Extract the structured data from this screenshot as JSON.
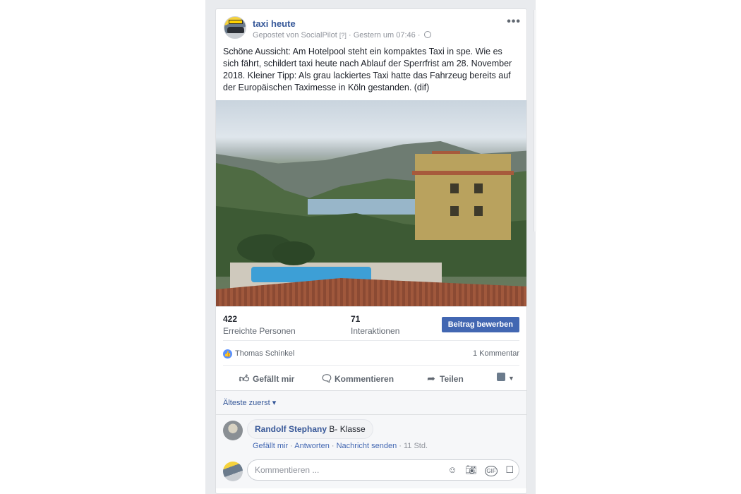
{
  "post": {
    "page_name": "taxi heute",
    "meta_prefix": "Gepostet von",
    "meta_tool": "SocialPilot",
    "meta_help": "[?]",
    "meta_time": "· Gestern um 07:46 ·",
    "text": "Schöne Aussicht: Am Hotelpool steht ein kompaktes Taxi in spe. Wie es sich fährt, schildert taxi heute nach Ablauf der Sperrfrist am 28. November 2018. Kleiner Tipp: Als grau lackiertes Taxi hatte das Fahrzeug bereits auf der Europäischen Taximesse in Köln gestanden. (dif)",
    "more": "•••"
  },
  "stats": {
    "reach_num": "422",
    "reach_label": "Erreichte Personen",
    "inter_num": "71",
    "inter_label": "Interaktionen",
    "boost": "Beitrag bewerben"
  },
  "reactions": {
    "liker": "Thomas Schinkel",
    "comment_count": "1 Kommentar"
  },
  "actions": {
    "like": "Gefällt mir",
    "comment": "Kommentieren",
    "share": "Teilen"
  },
  "sort": {
    "label": "Älteste zuerst ▾"
  },
  "comment": {
    "author": "Randolf Stephany",
    "text": "B- Klasse",
    "like": "Gefällt mir",
    "reply": "Antworten",
    "message": "Nachricht senden",
    "time": "11 Std."
  },
  "composer": {
    "placeholder": "Kommentieren ..."
  }
}
